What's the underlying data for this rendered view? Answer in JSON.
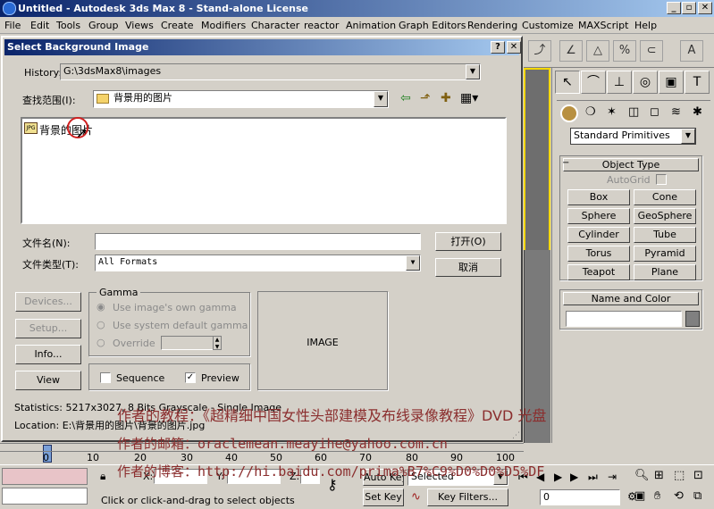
{
  "app": {
    "title": "Untitled - Autodesk 3ds Max 8 - Stand-alone License"
  },
  "menu": [
    "File",
    "Edit",
    "Tools",
    "Group",
    "Views",
    "Create",
    "Modifiers",
    "Character",
    "reactor",
    "Animation",
    "Graph Editors",
    "Rendering",
    "Customize",
    "MAXScript",
    "Help"
  ],
  "dialog": {
    "title": "Select Background Image",
    "help_btn": "?",
    "close_btn": "✕",
    "history_label": "History:",
    "history_value": "G:\\3dsMax8\\images",
    "lookin_label": "查找范围(I):",
    "lookin_value": "背景用的图片",
    "file_item": "背景的图片",
    "filename_label": "文件名(N):",
    "filename_value": "",
    "filetype_label": "文件类型(T):",
    "filetype_value": "All Formats",
    "open_btn": "打开(O)",
    "cancel_btn": "取消",
    "devices_btn": "Devices...",
    "setup_btn": "Setup...",
    "info_btn": "Info...",
    "view_btn": "View",
    "gamma": {
      "title": "Gamma",
      "opt1": "Use image's own gamma",
      "opt2": "Use system default gamma",
      "opt3": "Override",
      "override_value": ""
    },
    "sequence_label": "Sequence",
    "sequence_checked": false,
    "preview_label": "Preview",
    "preview_checked": true,
    "image_label": "IMAGE",
    "statistics": "Statistics:  5217x3027, 8 Bits Grayscale - Single Image",
    "location": "Location:  E:\\背景用的图片\\背景的图片.jpg"
  },
  "command_panel": {
    "primitives_dropdown": "Standard Primitives",
    "object_type_title": "Object Type",
    "autogrid_label": "AutoGrid",
    "buttons": [
      "Box",
      "Cone",
      "Sphere",
      "GeoSphere",
      "Cylinder",
      "Tube",
      "Torus",
      "Pyramid",
      "Teapot",
      "Plane"
    ],
    "name_color_title": "Name and Color",
    "name_value": "",
    "color": "#808080"
  },
  "timeline": {
    "ticks": [
      "0",
      "10",
      "20",
      "30",
      "40",
      "50",
      "60",
      "70",
      "80",
      "90",
      "100"
    ]
  },
  "status": {
    "prompt": "Click or click-and-drag to select objects",
    "x_label": "X:",
    "y_label": "Y:",
    "z_label": "Z:",
    "autokey_btn": "Auto Key",
    "setkey_btn": "Set Key",
    "selected_value": "Selected",
    "keyfilters_btn": "Key Filters...",
    "frame_value": "0"
  },
  "watermark": {
    "line1": "作者的教程：《超精细中国女性头部建模及布线录像教程》DVD 光盘",
    "line2": "作者的邮箱：oraclemean.meayihe@yahoo.com.cn",
    "line3": "作者的博客：http://hi.baidu.com/prima%B7%C9%D0%D0%D5%DF"
  },
  "colors": {
    "titlebar": "#0a246a",
    "face": "#d4d0c8",
    "viewport_border": "#f5d800",
    "watermark": "#8b2e2e",
    "color_swatch": "#808080"
  }
}
